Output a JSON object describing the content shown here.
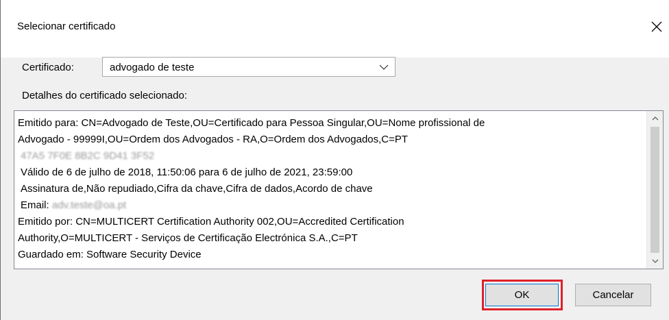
{
  "dialog": {
    "title": "Selecionar certificado",
    "close_icon": "close-icon"
  },
  "certificate": {
    "label": "Certificado:",
    "selected_value": "advogado de teste"
  },
  "details": {
    "label": "Detalhes do certificado selecionado:",
    "lines": [
      "Emitido para: CN=Advogado de Teste,OU=Certificado para Pessoa Singular,OU=Nome profissional de",
      "Advogado - 99999I,OU=Ordem dos Advogados - RA,O=Ordem dos Advogados,C=PT",
      "47A5 7F0E 8B2C 9D41 3F52",
      "Válido de 6 de julho de 2018, 11:50:06 para 6 de julho de 2021, 23:59:00",
      "Assinatura de,Não repudiado,Cifra da chave,Cifra de dados,Acordo de chave",
      "Email:",
      "Emitido por: CN=MULTICERT Certification Authority 002,OU=Accredited Certification",
      "Authority,O=MULTICERT - Serviços de Certificação Electrónica S.A.,C=PT",
      "Guardado em: Software Security Device"
    ],
    "email_redacted": "adv.teste@oa.pt"
  },
  "buttons": {
    "ok_label": "OK",
    "cancel_label": "Cancelar"
  },
  "colors": {
    "highlight": "#e0202a",
    "focus_border": "#0078d7"
  }
}
